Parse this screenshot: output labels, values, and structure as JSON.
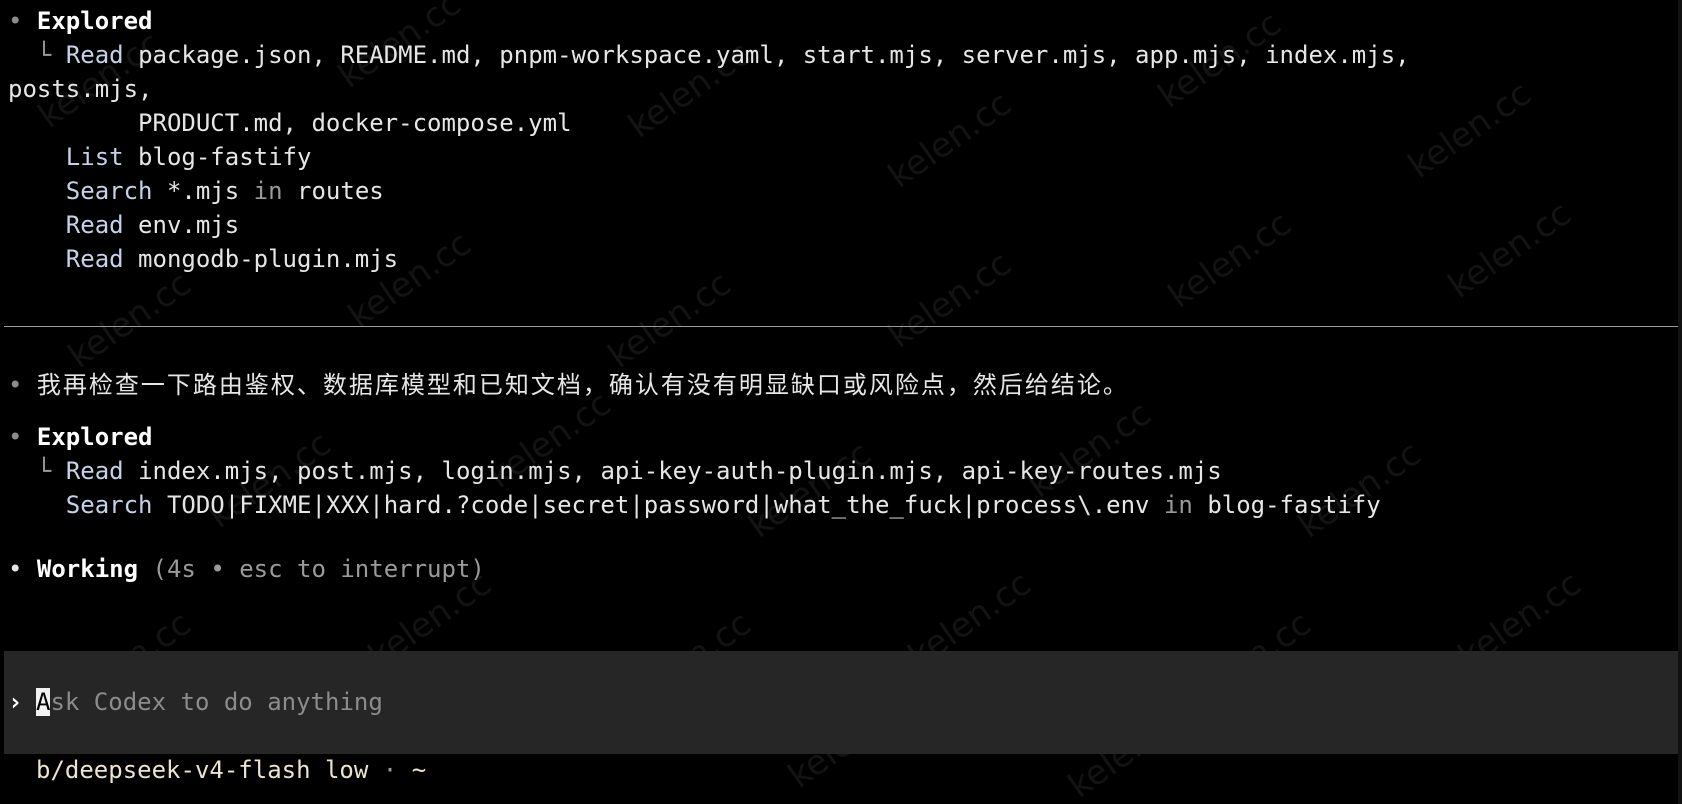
{
  "colors": {
    "background": "#000000",
    "text": "#e6e6e6",
    "muted": "#9a9a9a",
    "composer_bg": "#262626",
    "footer_text": "#ece3d0"
  },
  "watermark": "kelen.cc",
  "explored_1": {
    "bullet": "•",
    "title": "Explored",
    "branch": "└",
    "read_verb": "Read",
    "read_files_1": "package.json, README.md, pnpm-workspace.yaml, start.mjs, server.mjs, app.mjs, index.mjs,",
    "read_files_2": "posts.mjs,",
    "read_files_3": "PRODUCT.md, docker-compose.yml",
    "list_verb": "List",
    "list_target": "blog-fastify",
    "search_verb": "Search",
    "search_pattern": "*.mjs",
    "search_in": "in",
    "search_target": "routes",
    "read2_verb": "Read",
    "read2_file": "env.mjs",
    "read3_verb": "Read",
    "read3_file": "mongodb-plugin.mjs"
  },
  "message": {
    "bullet": "•",
    "text": "我再检查一下路由鉴权、数据库模型和已知文档，确认有没有明显缺口或风险点，然后给结论。"
  },
  "explored_2": {
    "bullet": "•",
    "title": "Explored",
    "branch": "└",
    "read_verb": "Read",
    "read_files": "index.mjs, post.mjs, login.mjs, api-key-auth-plugin.mjs, api-key-routes.mjs",
    "search_verb": "Search",
    "search_pattern": "TODO|FIXME|XXX|hard.?code|secret|password|what_the_fuck|process\\.env",
    "search_in": "in",
    "search_target": "blog-fastify"
  },
  "working": {
    "bullet": "•",
    "label": "Working",
    "status": "(4s • esc to interrupt)"
  },
  "composer": {
    "chevron": "›",
    "cursor_char": "A",
    "placeholder_rest": "sk Codex to do anything"
  },
  "footer": {
    "model": "b/deepseek-v4-flash low",
    "separator": "·",
    "path": "~"
  }
}
